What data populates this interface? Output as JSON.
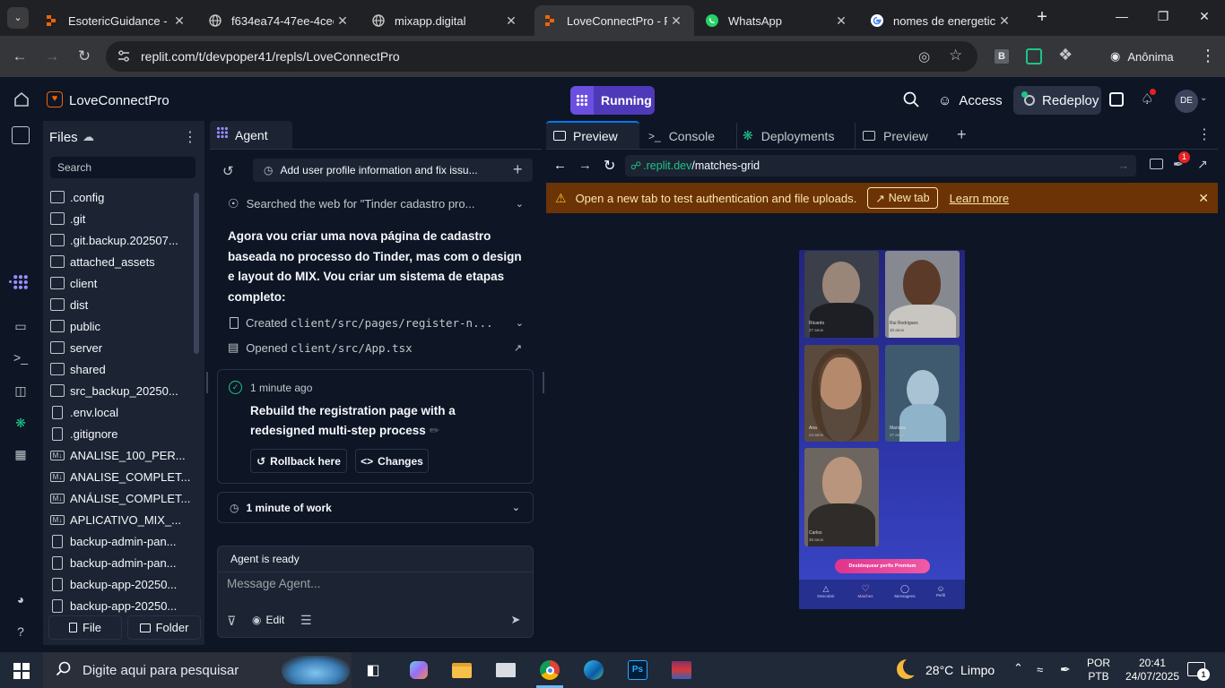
{
  "browser": {
    "tabs": [
      {
        "title": "EsotericGuidance - Re",
        "icon": "replit-icon",
        "active": false
      },
      {
        "title": "f634ea74-47ee-4cee-",
        "icon": "globe-icon",
        "active": false
      },
      {
        "title": "mixapp.digital",
        "icon": "globe-icon",
        "active": false
      },
      {
        "title": "LoveConnectPro - Re",
        "icon": "replit-icon",
        "active": true
      },
      {
        "title": "WhatsApp",
        "icon": "whatsapp-icon",
        "active": false
      },
      {
        "title": "nomes de energetico",
        "icon": "google-icon",
        "active": false
      }
    ],
    "url": "replit.com/t/devpoper41/repls/LoveConnectPro",
    "extension_b": "B",
    "profile": "Anônima"
  },
  "replit": {
    "project_name": "LoveConnectPro",
    "run_status": "Running",
    "access_label": "Access",
    "redeploy_label": "Redeploy",
    "avatar": "DE"
  },
  "files": {
    "title": "Files",
    "search_placeholder": "Search",
    "items": [
      {
        "name": ".config",
        "type": "folder"
      },
      {
        "name": ".git",
        "type": "folder"
      },
      {
        "name": ".git.backup.202507...",
        "type": "folder"
      },
      {
        "name": "attached_assets",
        "type": "folder"
      },
      {
        "name": "client",
        "type": "folder"
      },
      {
        "name": "dist",
        "type": "folder"
      },
      {
        "name": "public",
        "type": "folder"
      },
      {
        "name": "server",
        "type": "folder"
      },
      {
        "name": "shared",
        "type": "folder"
      },
      {
        "name": "src_backup_20250...",
        "type": "folder"
      },
      {
        "name": ".env.local",
        "type": "file"
      },
      {
        "name": ".gitignore",
        "type": "file"
      },
      {
        "name": "ANALISE_100_PER...",
        "type": "md"
      },
      {
        "name": "ANALISE_COMPLET...",
        "type": "md"
      },
      {
        "name": "ANÁLISE_COMPLET...",
        "type": "md"
      },
      {
        "name": "APLICATIVO_MIX_...",
        "type": "md"
      },
      {
        "name": "backup-admin-pan...",
        "type": "file"
      },
      {
        "name": "backup-admin-pan...",
        "type": "file"
      },
      {
        "name": "backup-app-20250...",
        "type": "file"
      },
      {
        "name": "backup-app-20250...",
        "type": "file"
      }
    ],
    "new_file_label": "File",
    "new_folder_label": "Folder"
  },
  "agent": {
    "tab_label": "Agent",
    "history_title": "Add user profile information and fix issu...",
    "search_step": "Searched the web for \"Tinder cadastro pro...",
    "message": "Agora vou criar uma nova página de cadastro baseada no processo do Tinder, mas com o design e layout do MIX. Vou criar um sistema de etapas completo:",
    "created_prefix": "Created ",
    "created_path": "client/src/pages/register-n...",
    "opened_prefix": "Opened ",
    "opened_path": "client/src/App.tsx",
    "checkpoint_time": "1 minute ago",
    "checkpoint_title": "Rebuild the registration page with a redesigned multi-step process",
    "rollback_label": "Rollback here",
    "changes_label": "Changes",
    "work_label": "1 minute of work",
    "status": "Agent is ready",
    "input_placeholder": "Message Agent...",
    "edit_label": "Edit"
  },
  "preview": {
    "tabs": [
      "Preview",
      "Console",
      "Deployments",
      "Preview"
    ],
    "url_domain": ".replit.dev",
    "url_path": "/matches-grid",
    "notif_count": "1",
    "banner_text": "Open a new tab to test authentication and file uploads.",
    "banner_button": "New tab",
    "banner_link": "Learn more",
    "phone": {
      "profiles": [
        {
          "name": "Ricardo",
          "age": "27 anos"
        },
        {
          "name": "Rui Rodrigues",
          "age": "30 anos"
        },
        {
          "name": "Ana",
          "age": "24 anos"
        },
        {
          "name": "Mariana",
          "age": "27 anos"
        },
        {
          "name": "Carlos",
          "age": "26 anos"
        }
      ],
      "cta": "Desbloquear perfis Premium",
      "nav": [
        "Descobrir",
        "Matches",
        "Mensagens",
        "Perfil"
      ]
    }
  },
  "taskbar": {
    "search_placeholder": "Digite aqui para pesquisar",
    "weather": "28°C  Limpo",
    "lang_top": "POR",
    "lang_bottom": "PTB",
    "time": "20:41",
    "date": "24/07/2025",
    "notif_count": "1"
  }
}
